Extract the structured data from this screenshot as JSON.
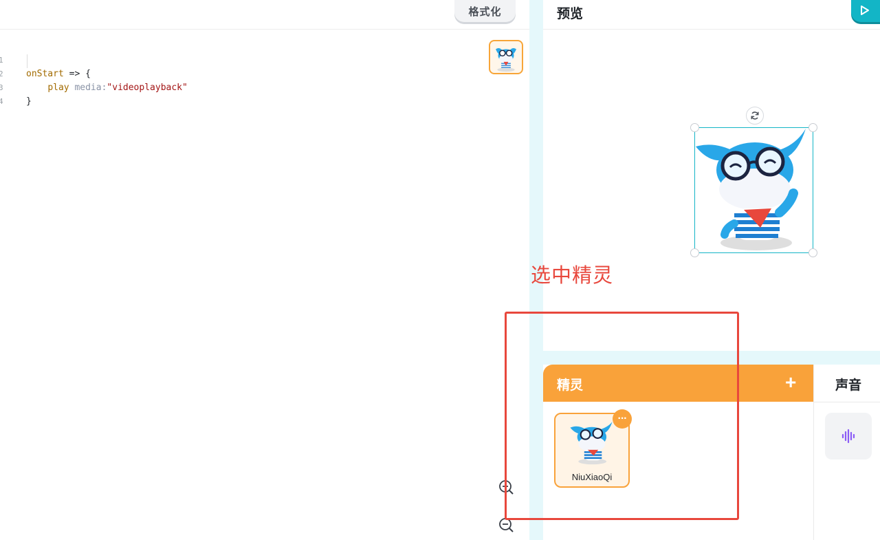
{
  "editor": {
    "format_label": "格式化",
    "lines": [
      {
        "no": "1",
        "indent": "",
        "fn": "onStart",
        "rest": " => {"
      },
      {
        "no": "2",
        "indent": "    ",
        "cmd": "play",
        "attr": "media:",
        "str": "\"videoplayback\""
      },
      {
        "no": "3",
        "brace": "}"
      },
      {
        "no": "4"
      }
    ],
    "zoom_in_icon": "zoom-in-icon",
    "zoom_out_icon": "zoom-out-icon"
  },
  "preview": {
    "title": "预览",
    "run_icon": "play-icon",
    "rotate_icon": "refresh-icon"
  },
  "annotation": {
    "text": "选中精灵",
    "color": "#e8473c"
  },
  "sprites": {
    "title": "精灵",
    "add_label": "+",
    "items": [
      {
        "name": "NiuXiaoQi"
      }
    ],
    "more_label": "···"
  },
  "sounds": {
    "title": "声音",
    "items": [
      {
        "icon": "sound-wave-icon"
      }
    ]
  },
  "colors": {
    "accent": "#13b5c6",
    "sprites_orange": "#f9a23a",
    "separator": "#e5f8fb",
    "sound_icon": "#8b5cf6"
  }
}
